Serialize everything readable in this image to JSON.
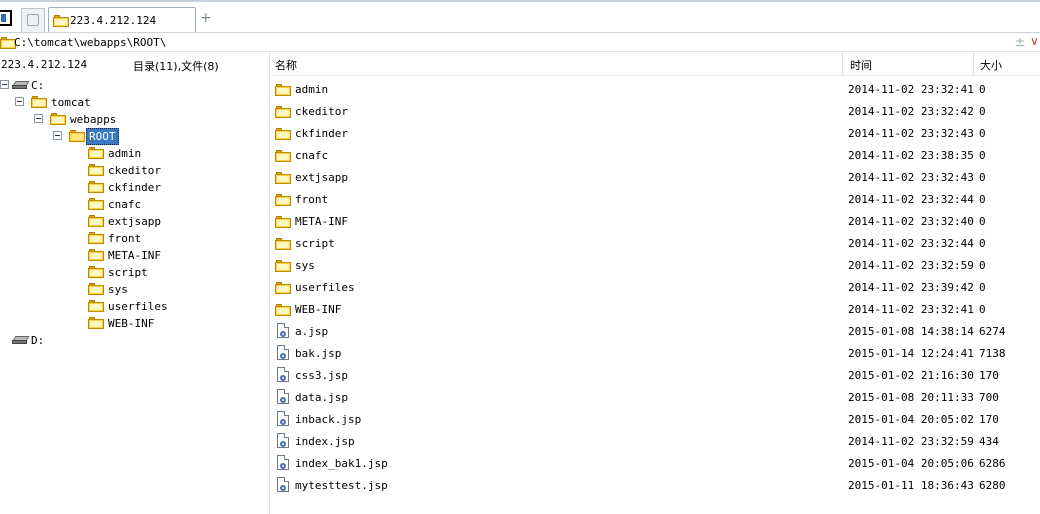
{
  "tabbar": {
    "active_tab_label": "223.4.212.124",
    "add_tab_glyph": "+"
  },
  "address": {
    "path": "C:\\tomcat\\webapps\\ROOT\\",
    "btn1_glyph": "±",
    "btn2_glyph": "∨"
  },
  "left": {
    "host": "223.4.212.124",
    "counts": "目录(11),文件(8)",
    "tree": {
      "drive_c": "C:",
      "tomcat": "tomcat",
      "webapps": "webapps",
      "root": "ROOT",
      "children": [
        "admin",
        "ckeditor",
        "ckfinder",
        "cnafc",
        "extjsapp",
        "front",
        "META-INF",
        "script",
        "sys",
        "userfiles",
        "WEB-INF"
      ],
      "drive_d": "D:"
    }
  },
  "columns": {
    "name": "名称",
    "time": "时间",
    "size": "大小"
  },
  "rows": [
    {
      "type": "folder",
      "name": "admin",
      "time": "2014-11-02 23:32:41",
      "size": "0"
    },
    {
      "type": "folder",
      "name": "ckeditor",
      "time": "2014-11-02 23:32:42",
      "size": "0"
    },
    {
      "type": "folder",
      "name": "ckfinder",
      "time": "2014-11-02 23:32:43",
      "size": "0"
    },
    {
      "type": "folder",
      "name": "cnafc",
      "time": "2014-11-02 23:38:35",
      "size": "0"
    },
    {
      "type": "folder",
      "name": "extjsapp",
      "time": "2014-11-02 23:32:43",
      "size": "0"
    },
    {
      "type": "folder",
      "name": "front",
      "time": "2014-11-02 23:32:44",
      "size": "0"
    },
    {
      "type": "folder",
      "name": "META-INF",
      "time": "2014-11-02 23:32:40",
      "size": "0"
    },
    {
      "type": "folder",
      "name": "script",
      "time": "2014-11-02 23:32:44",
      "size": "0"
    },
    {
      "type": "folder",
      "name": "sys",
      "time": "2014-11-02 23:32:59",
      "size": "0"
    },
    {
      "type": "folder",
      "name": "userfiles",
      "time": "2014-11-02 23:39:42",
      "size": "0"
    },
    {
      "type": "folder",
      "name": "WEB-INF",
      "time": "2014-11-02 23:32:41",
      "size": "0"
    },
    {
      "type": "file",
      "name": "a.jsp",
      "time": "2015-01-08 14:38:14",
      "size": "6274"
    },
    {
      "type": "file",
      "name": "bak.jsp",
      "time": "2015-01-14 12:24:41",
      "size": "7138"
    },
    {
      "type": "file",
      "name": "css3.jsp",
      "time": "2015-01-02 21:16:30",
      "size": "170"
    },
    {
      "type": "file",
      "name": "data.jsp",
      "time": "2015-01-08 20:11:33",
      "size": "700"
    },
    {
      "type": "file",
      "name": "inback.jsp",
      "time": "2015-01-04 20:05:02",
      "size": "170"
    },
    {
      "type": "file",
      "name": "index.jsp",
      "time": "2014-11-02 23:32:59",
      "size": "434"
    },
    {
      "type": "file",
      "name": "index_bak1.jsp",
      "time": "2015-01-04 20:05:06",
      "size": "6286"
    },
    {
      "type": "file",
      "name": "mytesttest.jsp",
      "time": "2015-01-11 18:36:43",
      "size": "6280"
    }
  ]
}
